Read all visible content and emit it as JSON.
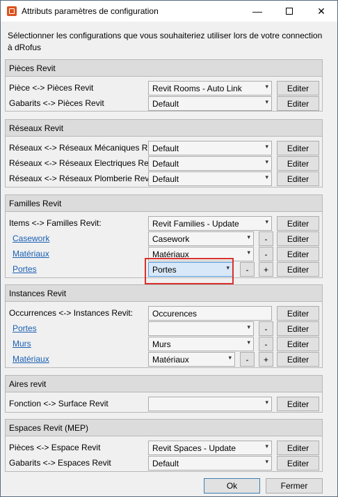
{
  "window": {
    "title": "Attributs paramètres de configuration",
    "minimize": "—",
    "close": "✕"
  },
  "intro": "Sélectionner les configurations que vous souhaiteriez utiliser lors de votre connection à dRofus",
  "groups": {
    "pieces": {
      "title": "Pièces Revit",
      "rows": [
        {
          "label": "Pièce <-> Pièces Revit",
          "value": "Revit Rooms - Auto Link",
          "button": "Editer"
        },
        {
          "label": "Gabarits <-> Pièces Revit",
          "value": "Default",
          "button": "Editer"
        }
      ]
    },
    "reseaux": {
      "title": "Réseaux Revit",
      "rows": [
        {
          "label": "Réseaux <-> Réseaux Mécaniques Revit",
          "value": "Default",
          "button": "Editer"
        },
        {
          "label": "Réseaux <-> Réseaux Electriques Revit",
          "value": "Default",
          "button": "Editer"
        },
        {
          "label": "Réseaux <-> Réseaux Plomberie Revit",
          "value": "Default",
          "button": "Editer"
        }
      ]
    },
    "familles": {
      "title": "Familles Revit",
      "rows": [
        {
          "label": "Items <-> Familles Revit:",
          "value": "Revit Families - Update",
          "button": "Editer"
        },
        {
          "label": "Casework",
          "value": "Casework",
          "minus": "-",
          "button": "Editer"
        },
        {
          "label": "Matériaux",
          "value": "Matériaux",
          "minus": "-",
          "button": "Editer"
        },
        {
          "label": "Portes",
          "value": "Portes",
          "minus": "-",
          "plus": "+",
          "button": "Editer"
        }
      ]
    },
    "instances": {
      "title": "Instances Revit",
      "rows": [
        {
          "label": "Occurrences <-> Instances Revit:",
          "value": "Occurences",
          "button": "Editer"
        },
        {
          "label": "Portes",
          "value": "",
          "minus": "-",
          "button": "Editer"
        },
        {
          "label": "Murs",
          "value": "Murs",
          "minus": "-",
          "button": "Editer"
        },
        {
          "label": "Matériaux",
          "value": "Matériaux",
          "minus": "-",
          "plus": "+",
          "button": "Editer"
        }
      ]
    },
    "aires": {
      "title": "Aires revit",
      "rows": [
        {
          "label": "Fonction <-> Surface Revit",
          "value": "",
          "button": "Editer"
        }
      ]
    },
    "espaces": {
      "title": "Espaces Revit (MEP)",
      "rows": [
        {
          "label": "Pièces <-> Espace Revit",
          "value": "Revit Spaces - Update",
          "button": "Editer"
        },
        {
          "label": "Gabarits <-> Espaces Revit",
          "value": "Default",
          "button": "Editer"
        }
      ]
    }
  },
  "footer": {
    "ok": "Ok",
    "cancel": "Fermer"
  }
}
